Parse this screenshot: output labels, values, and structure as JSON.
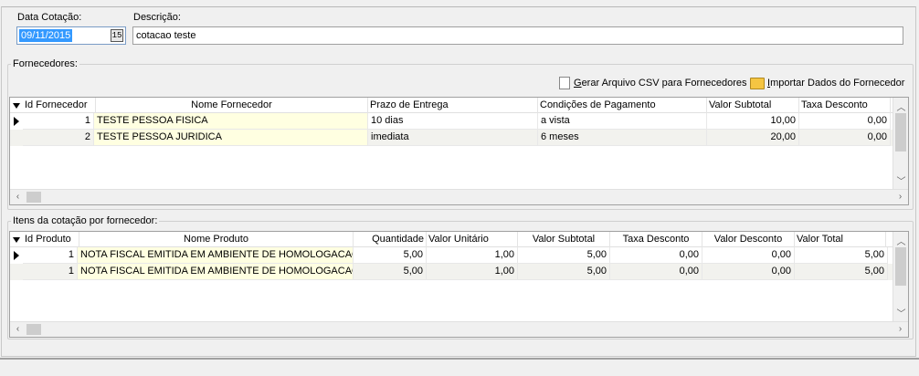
{
  "header": {
    "date_label": "Data Cotação:",
    "date_value": "09/11/2015",
    "calendar_glyph": "15",
    "description_label": "Descrição:",
    "description_value": "cotacao teste"
  },
  "suppliers": {
    "group_title": "Fornecedores:",
    "csv_button": "Gerar Arquivo CSV para Fornecedores",
    "csv_button_underline": "G",
    "import_button": "Importar Dados do Fornecedor",
    "import_button_underline": "I",
    "columns": [
      "Id Fornecedor",
      "Nome Fornecedor",
      "Prazo de Entrega",
      "Condições de Pagamento",
      "Valor Subtotal",
      "Taxa Desconto"
    ],
    "rows": [
      {
        "id": "1",
        "name": "TESTE PESSOA FISICA",
        "prazo": "10 dias",
        "condicoes": "a vista",
        "subtotal": "10,00",
        "taxa": "0,00"
      },
      {
        "id": "2",
        "name": "TESTE PESSOA JURIDICA",
        "prazo": "imediata",
        "condicoes": "6 meses",
        "subtotal": "20,00",
        "taxa": "0,00"
      }
    ]
  },
  "items": {
    "group_title": "Itens da cotação por fornecedor:",
    "columns": [
      "Id Produto",
      "Nome Produto",
      "Quantidade",
      "Valor Unitário",
      "Valor Subtotal",
      "Taxa Desconto",
      "Valor Desconto",
      "Valor Total"
    ],
    "rows": [
      {
        "id": "1",
        "name": "NOTA FISCAL EMITIDA EM AMBIENTE DE HOMOLOGACAO - SE",
        "qtd": "5,00",
        "unit": "1,00",
        "subtotal": "5,00",
        "taxa": "0,00",
        "desconto": "0,00",
        "total": "5,00"
      },
      {
        "id": "1",
        "name": "NOTA FISCAL EMITIDA EM AMBIENTE DE HOMOLOGACAO - SE",
        "qtd": "5,00",
        "unit": "1,00",
        "subtotal": "5,00",
        "taxa": "0,00",
        "desconto": "0,00",
        "total": "5,00"
      }
    ]
  },
  "icons": {
    "indicator": "row-indicator-triangle",
    "csv": "csv-file-icon",
    "import": "import-folder-icon"
  }
}
